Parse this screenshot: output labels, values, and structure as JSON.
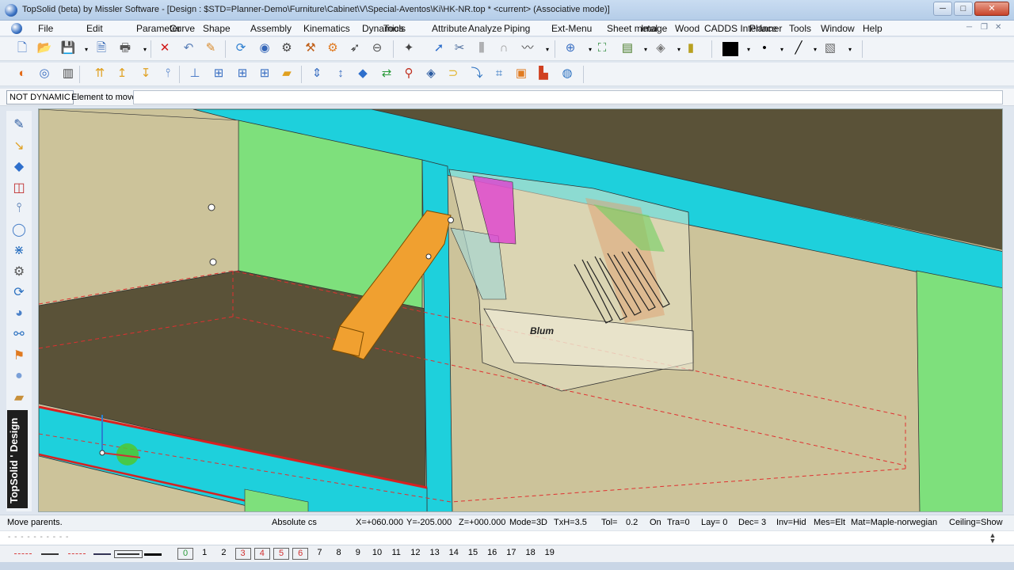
{
  "window": {
    "title": "TopSolid (beta) by Missler Software - [Design : $STD=Planner-Demo\\Furniture\\Cabinet\\V\\Special-Aventos\\Ki\\HK-NR.top * <current> (Associative mode)]",
    "buttons": {
      "minimize": "─",
      "maximize": "□",
      "close": "✕"
    }
  },
  "menu": {
    "items": [
      "File",
      "Edit",
      "Parameter",
      "Curve",
      "Shape",
      "Assembly",
      "Kinematics",
      "Dynamics",
      "Tools",
      "Attribute",
      "Analyze",
      "Piping",
      "Ext-Menu",
      "Sheet metal",
      "Image",
      "Wood",
      "CADDS Interface",
      "Planner",
      "Tools",
      "Window",
      "Help"
    ],
    "mdi": {
      "minimize": "─",
      "restore": "❐",
      "close": "✕"
    }
  },
  "toolbar1": {
    "icons": [
      {
        "name": "new-document-icon",
        "glyph": "🗋",
        "color": "#3a6fc2"
      },
      {
        "name": "open-folder-icon",
        "glyph": "📂",
        "color": "#d8a230"
      },
      {
        "name": "save-icon",
        "glyph": "💾",
        "color": "#2b4f9a"
      },
      {
        "name": "document-properties-icon",
        "glyph": "🗎",
        "color": "#2f63b4"
      },
      {
        "name": "print-icon",
        "glyph": "🖶",
        "color": "#555"
      },
      {
        "name": "delete-icon",
        "glyph": "✕",
        "color": "#d01818"
      },
      {
        "name": "undo-icon",
        "glyph": "↶",
        "color": "#5a7fb8"
      },
      {
        "name": "eraser-icon",
        "glyph": "✎",
        "color": "#d98a2b"
      },
      {
        "name": "regenerate-icon",
        "glyph": "⟳",
        "color": "#2d7fd0"
      },
      {
        "name": "view-icon",
        "glyph": "◉",
        "color": "#3466b8"
      },
      {
        "name": "settings-sliders-icon",
        "glyph": "⚙",
        "color": "#444"
      },
      {
        "name": "hammer-icon",
        "glyph": "⚒",
        "color": "#c0601a"
      },
      {
        "name": "gears-icon",
        "glyph": "⚙",
        "color": "#e07a20"
      },
      {
        "name": "pointer-tool-icon",
        "glyph": "➶",
        "color": "#333"
      },
      {
        "name": "orbit-icon",
        "glyph": "⊖",
        "color": "#555"
      },
      {
        "name": "compass-icon",
        "glyph": "✦",
        "color": "#444"
      },
      {
        "name": "select-arrow-icon",
        "glyph": "➚",
        "color": "#2e6fcc"
      },
      {
        "name": "cut-icon",
        "glyph": "✂",
        "color": "#4a6b9b"
      },
      {
        "name": "pins-icon",
        "glyph": "⫼",
        "color": "#666"
      },
      {
        "name": "magnet-icon",
        "glyph": "∩",
        "color": "#999"
      },
      {
        "name": "curve-tool-icon",
        "glyph": "〰",
        "color": "#444"
      },
      {
        "name": "zoom-icon",
        "glyph": "⊕",
        "color": "#3a6fc2"
      },
      {
        "name": "zoom-fit-icon",
        "glyph": "⛶",
        "color": "#2e8a3b"
      },
      {
        "name": "layers-icon",
        "glyph": "▤",
        "color": "#4b7d2c"
      },
      {
        "name": "paint-bucket-icon",
        "glyph": "◈",
        "color": "#777"
      },
      {
        "name": "battery-icon",
        "glyph": "▮",
        "color": "#b8a020"
      },
      {
        "name": "dot-style-icon",
        "glyph": "•",
        "color": "#000"
      },
      {
        "name": "line-style-icon",
        "glyph": "╱",
        "color": "#000"
      },
      {
        "name": "hatch-icon",
        "glyph": "▧",
        "color": "#666"
      }
    ]
  },
  "toolbar2": {
    "icons": [
      {
        "name": "origin-icon",
        "glyph": "◐",
        "color": "#e36a17"
      },
      {
        "name": "circle-target-icon",
        "glyph": "◎",
        "color": "#3a6fc2"
      },
      {
        "name": "bars-icon",
        "glyph": "▥",
        "color": "#444"
      },
      {
        "name": "arrows-up-icon",
        "glyph": "⇈",
        "color": "#e0a020"
      },
      {
        "name": "arrow-up-icon",
        "glyph": "↥",
        "color": "#e0a020"
      },
      {
        "name": "arrow-down-icon",
        "glyph": "↧",
        "color": "#e0a020"
      },
      {
        "name": "pin-icon",
        "glyph": "⫯",
        "color": "#3a6fc2"
      },
      {
        "name": "frame-up-icon",
        "glyph": "⊥",
        "color": "#3a6fc2"
      },
      {
        "name": "align-left-icon",
        "glyph": "⊞",
        "color": "#3a6fc2"
      },
      {
        "name": "align-center-icon",
        "glyph": "⊞",
        "color": "#3a6fc2"
      },
      {
        "name": "align-right-icon",
        "glyph": "⊞",
        "color": "#3a6fc2"
      },
      {
        "name": "panel-icon",
        "glyph": "▰",
        "color": "#e0a020"
      },
      {
        "name": "vertical-arrows-icon",
        "glyph": "⇕",
        "color": "#3a6fc2"
      },
      {
        "name": "vertical-arrow-icon",
        "glyph": "↕",
        "color": "#3a6fc2"
      },
      {
        "name": "blue-box-icon",
        "glyph": "◆",
        "color": "#2e6fcc"
      },
      {
        "name": "green-swap-icon",
        "glyph": "⇄",
        "color": "#2a9a3a"
      },
      {
        "name": "search-part-icon",
        "glyph": "⚲",
        "color": "#c03020"
      },
      {
        "name": "cube-icon",
        "glyph": "◈",
        "color": "#2a5aa0"
      },
      {
        "name": "hinge-icon",
        "glyph": "⊃",
        "color": "#e0b020"
      },
      {
        "name": "drill-icon",
        "glyph": "⤵",
        "color": "#2a70c0"
      },
      {
        "name": "grid-arrows-icon",
        "glyph": "⌗",
        "color": "#2a70c0"
      },
      {
        "name": "box-tool-icon",
        "glyph": "▣",
        "color": "#e07a20"
      },
      {
        "name": "color-drop-icon",
        "glyph": "▙",
        "color": "#d04020"
      },
      {
        "name": "globe-refresh-icon",
        "glyph": "◍",
        "color": "#2a70c0"
      }
    ]
  },
  "dynamic_row": {
    "mode": "NOT DYNAMIC",
    "label": "Element to move:",
    "value": ""
  },
  "left_toolbar": {
    "icons": [
      {
        "name": "pencil-icon",
        "glyph": "✎",
        "color": "#2a5aa0"
      },
      {
        "name": "curve-icon",
        "glyph": "↘",
        "color": "#e0a020"
      },
      {
        "name": "solid-box-icon",
        "glyph": "◆",
        "color": "#2e6fcc"
      },
      {
        "name": "sketch-icon",
        "glyph": "◫",
        "color": "#c03030"
      },
      {
        "name": "screw-icon",
        "glyph": "⫯",
        "color": "#2a5aa0"
      },
      {
        "name": "selection-circle-icon",
        "glyph": "◯",
        "color": "#4a80c8"
      },
      {
        "name": "network-icon",
        "glyph": "⋇",
        "color": "#2a70c0"
      },
      {
        "name": "gear-tool-icon",
        "glyph": "⚙",
        "color": "#555"
      },
      {
        "name": "refresh-tool-icon",
        "glyph": "⟳",
        "color": "#2a70c0"
      },
      {
        "name": "shape-icon",
        "glyph": "◕",
        "color": "#4a80c8"
      },
      {
        "name": "chain-icon",
        "glyph": "⚯",
        "color": "#2a70c0"
      },
      {
        "name": "flag-icon",
        "glyph": "⚑",
        "color": "#e07a20"
      },
      {
        "name": "sphere-icon",
        "glyph": "●",
        "color": "#7aa0d8"
      },
      {
        "name": "plank-icon",
        "glyph": "▰",
        "color": "#c8903a"
      }
    ],
    "brand": "TopSolid ' Design"
  },
  "viewport": {
    "label": "Blum",
    "colors": {
      "cyan_panel": "#1ed0dc",
      "green_panel": "#7ee07c",
      "tan_panel": "#c8bf8e",
      "dark_panel": "#5a5238",
      "orange_arm": "#f0a030",
      "magenta_part": "#e040d0",
      "red_edge": "#d82020"
    }
  },
  "status": {
    "message": "Move parents.",
    "coord_system": "Absolute cs",
    "x": "X=+060.000",
    "y": "Y=-205.000",
    "z": "Z=+000.000",
    "mode": "Mode=3D",
    "txh": "TxH=3.5",
    "tol_label": "Tol=",
    "tol_value": "0.2",
    "on": "On",
    "tra": "Tra=0",
    "layer": "Lay= 0",
    "dec": "Dec= 3",
    "inv": "Inv=Hid",
    "mes": "Mes=Elt",
    "mat": "Mat=Maple-norwegian",
    "ceiling": "Ceiling=Show"
  },
  "command_line": {
    "dashes": "- - - - - - - - - -"
  },
  "bottom_bar": {
    "line_styles": [
      {
        "name": "dash-dot-red-line",
        "color": "#d84040"
      },
      {
        "name": "thin-black-line",
        "color": "#333333"
      },
      {
        "name": "dashed-red-line",
        "color": "#d84040"
      },
      {
        "name": "thin-blue-line",
        "color": "#335"
      },
      {
        "name": "selected-line",
        "color": "#333333"
      },
      {
        "name": "thick-black-line",
        "color": "#000000"
      }
    ],
    "layers": [
      {
        "label": "0",
        "color": "#2a9a3a",
        "boxed": true
      },
      {
        "label": "1",
        "color": "#000",
        "boxed": false
      },
      {
        "label": "2",
        "color": "#000",
        "boxed": false
      },
      {
        "label": "3",
        "color": "#d03030",
        "boxed": true
      },
      {
        "label": "4",
        "color": "#d03030",
        "boxed": true
      },
      {
        "label": "5",
        "color": "#d03030",
        "boxed": true
      },
      {
        "label": "6",
        "color": "#d03030",
        "boxed": true
      },
      {
        "label": "7",
        "color": "#000",
        "boxed": false
      },
      {
        "label": "8",
        "color": "#000",
        "boxed": false
      },
      {
        "label": "9",
        "color": "#000",
        "boxed": false
      },
      {
        "label": "10",
        "color": "#000",
        "boxed": false
      },
      {
        "label": "11",
        "color": "#000",
        "boxed": false
      },
      {
        "label": "12",
        "color": "#000",
        "boxed": false
      },
      {
        "label": "13",
        "color": "#000",
        "boxed": false
      },
      {
        "label": "14",
        "color": "#000",
        "boxed": false
      },
      {
        "label": "15",
        "color": "#000",
        "boxed": false
      },
      {
        "label": "16",
        "color": "#000",
        "boxed": false
      },
      {
        "label": "17",
        "color": "#000",
        "boxed": false
      },
      {
        "label": "18",
        "color": "#000",
        "boxed": false
      },
      {
        "label": "19",
        "color": "#000",
        "boxed": false
      }
    ]
  }
}
